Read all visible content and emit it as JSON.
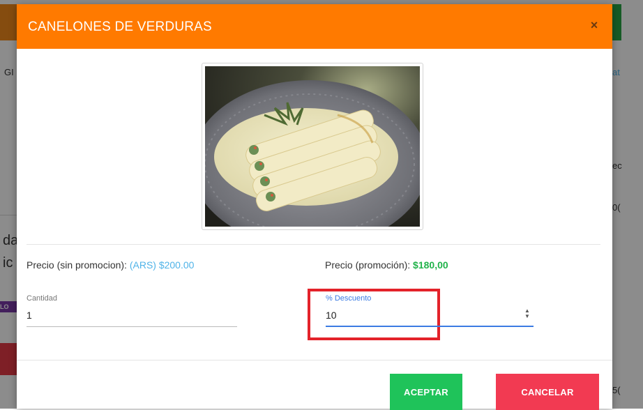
{
  "modal": {
    "title": "CANELONES DE VERDURAS",
    "close_symbol": "×",
    "image_name": "canelones-photo"
  },
  "prices": {
    "regular_label": "Precio (sin promocion): ",
    "regular_value": "(ARS) $200.00",
    "promo_label": "Precio (promoción): ",
    "promo_value": "$180,00"
  },
  "fields": {
    "quantity_label": "Cantidad",
    "quantity_value": "1",
    "discount_label": "% Descuento",
    "discount_value": "10"
  },
  "buttons": {
    "accept": "ACEPTAR",
    "cancel": "CANCELAR"
  },
  "background": {
    "frag_1": "GI",
    "frag_2": "at",
    "frag_3": "ec",
    "frag_4": "0(",
    "frag_5": "da",
    "frag_6": "ic",
    "frag_7": "LO",
    "frag_8": "5("
  },
  "colors": {
    "header": "#ff7a00",
    "accept": "#1fc35a",
    "cancel": "#f23a52",
    "highlight": "#e3222a",
    "focus": "#3b7be3"
  }
}
